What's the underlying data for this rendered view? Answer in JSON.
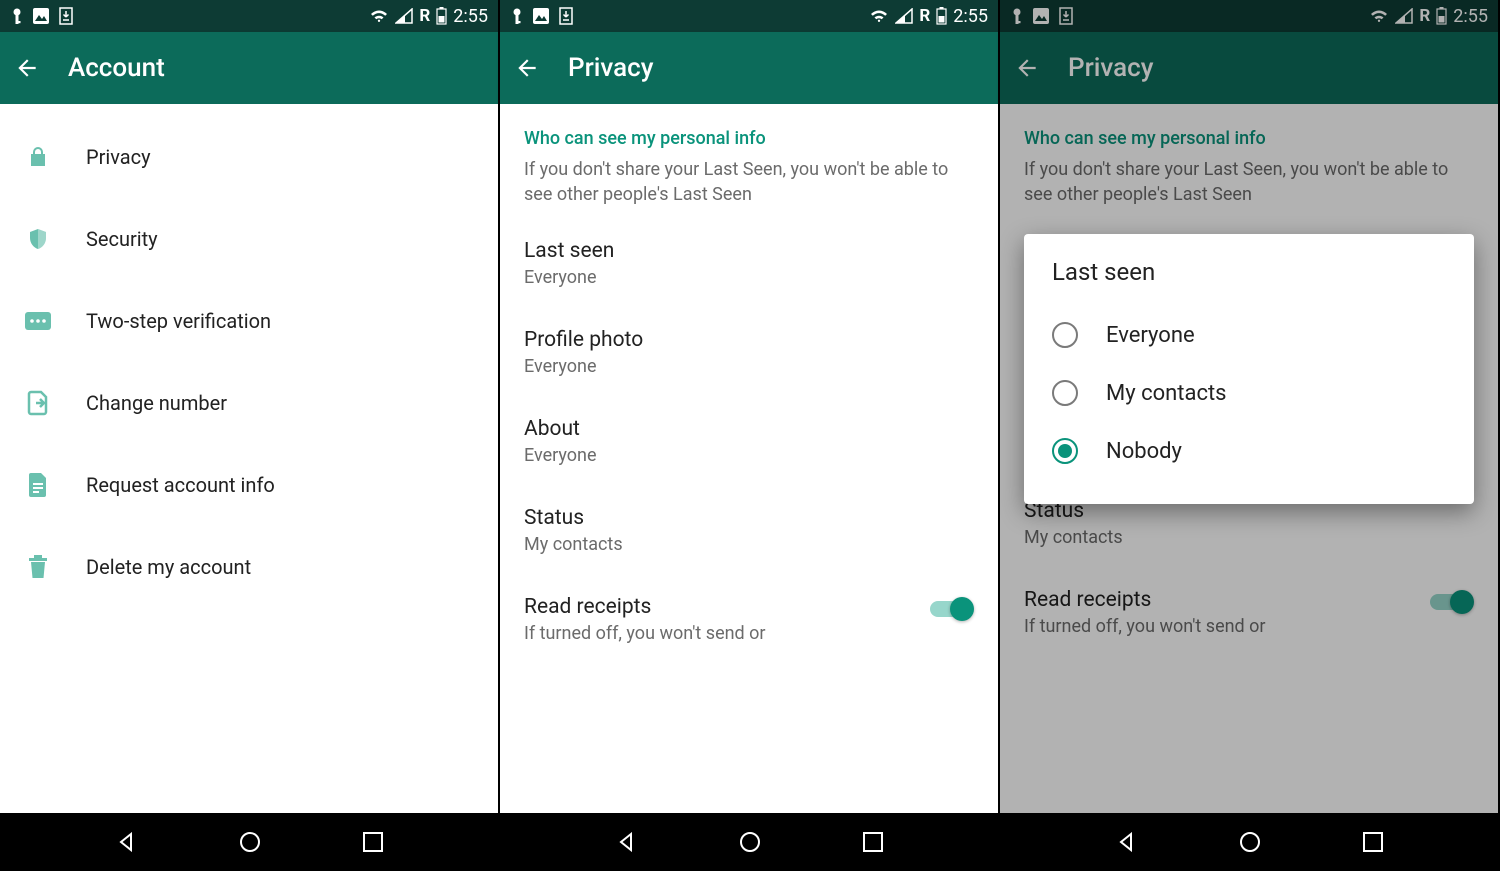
{
  "status": {
    "time": "2:55",
    "r_label": "R"
  },
  "screens": [
    {
      "appbar_title": "Account",
      "items": [
        {
          "label": "Privacy",
          "icon": "lock-icon"
        },
        {
          "label": "Security",
          "icon": "shield-icon"
        },
        {
          "label": "Two-step verification",
          "icon": "dots-icon"
        },
        {
          "label": "Change number",
          "icon": "sim-icon"
        },
        {
          "label": "Request account info",
          "icon": "document-icon"
        },
        {
          "label": "Delete my account",
          "icon": "trash-icon"
        }
      ]
    },
    {
      "appbar_title": "Privacy",
      "section_header": "Who can see my personal info",
      "section_desc": "If you don't share your Last Seen, you won't be able to see other people's Last Seen",
      "prefs": [
        {
          "title": "Last seen",
          "sub": "Everyone"
        },
        {
          "title": "Profile photo",
          "sub": "Everyone"
        },
        {
          "title": "About",
          "sub": "Everyone"
        },
        {
          "title": "Status",
          "sub": "My contacts"
        }
      ],
      "read_receipts": {
        "title": "Read receipts",
        "desc": "If turned off, you won't send or",
        "on": true
      }
    },
    {
      "appbar_title": "Privacy",
      "section_header": "Who can see my personal info",
      "section_desc": "If you don't share your Last Seen, you won't be able to see other people's Last Seen",
      "visible_prefs": [
        {
          "title": "Status",
          "sub": "My contacts"
        }
      ],
      "read_receipts": {
        "title": "Read receipts",
        "desc": "If turned off, you won't send or",
        "on": true
      },
      "dialog": {
        "title": "Last seen",
        "options": [
          {
            "label": "Everyone",
            "checked": false
          },
          {
            "label": "My contacts",
            "checked": false
          },
          {
            "label": "Nobody",
            "checked": true
          }
        ]
      }
    }
  ]
}
